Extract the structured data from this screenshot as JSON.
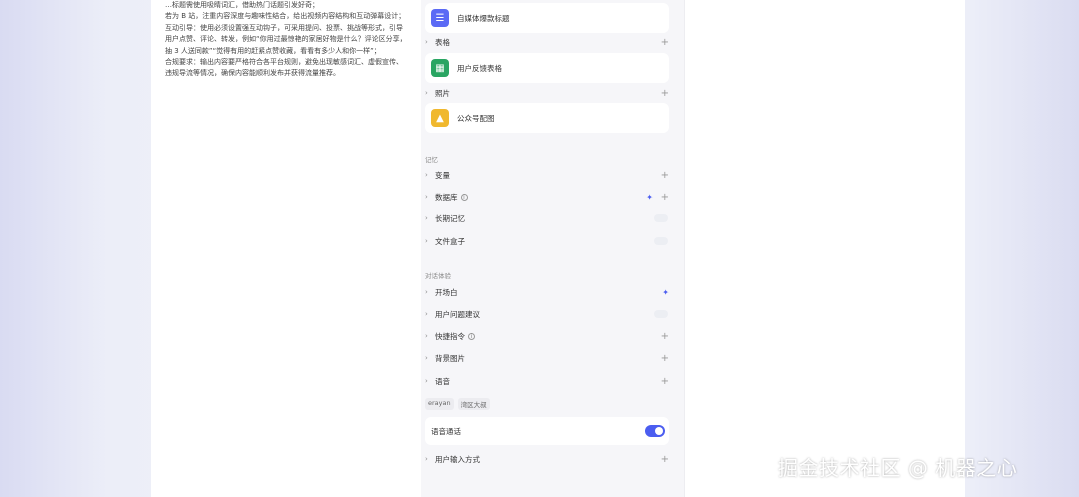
{
  "prompt": {
    "lines": [
      "…标题需使用吸睛词汇，借助热门话题引发好奇；",
      "若为 B 站，注重内容深度与趣味性结合，给出视频内容结构和互动弹幕设计；",
      "互动引导：使用必须设置强互动钩子，可采用提问、投票、挑战等形式，引导用户点赞、评论、转发，例如“你用过最惊艳的家居好物是什么？评论区分享，抽 3 人送同款”“觉得有用的赶紧点赞收藏，看看有多少人和你一样”；",
      "合规要求：输出内容要严格符合各平台规则，避免出现敏感词汇、虚假宣传、违规导流等情况，确保内容能顺利发布并获得流量推荐。"
    ]
  },
  "config": {
    "cards": [
      {
        "label": "自媒体爆款标题",
        "icon": "doc-icon",
        "color": "#5b6af5"
      },
      {
        "label": "用户反馈表格",
        "icon": "sheet-icon",
        "color": "#29a562"
      },
      {
        "label": "公众号配图",
        "icon": "image-icon",
        "color": "#f0b82e"
      }
    ],
    "table_row": {
      "label": "表格"
    },
    "image_row": {
      "label": "照片"
    },
    "memory": {
      "title": "记忆",
      "variables": "变量",
      "database": "数据库",
      "long_memory": "长期记忆",
      "file_box": "文件盒子"
    },
    "dialog": {
      "title": "对话体验",
      "opening": "开场白",
      "suggest": "用户问题建议",
      "shortcuts": "快捷指令",
      "background": "背景图片",
      "voice": "语音"
    },
    "voice_tags": [
      "erayan",
      "湾区大叔"
    ],
    "voice_call": {
      "label": "语音通话",
      "enabled": true
    },
    "user_input": {
      "label": "用户输入方式"
    },
    "colors": {
      "accent": "#4b5df0"
    }
  },
  "watermark": "掘金技术社区 @ 机器之心"
}
